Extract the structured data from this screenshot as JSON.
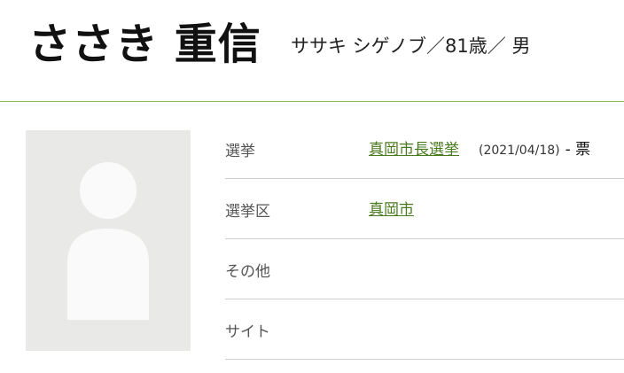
{
  "candidate": {
    "name": "ささき 重信",
    "subtitle": "ササキ シゲノブ／81歳／ 男"
  },
  "photo": {
    "icon": "person-placeholder-icon"
  },
  "details": {
    "election": {
      "label": "選挙",
      "link": "真岡市長選挙",
      "date": "(2021/04/18)",
      "votes": "- 票"
    },
    "district": {
      "label": "選挙区",
      "link": "真岡市"
    },
    "other": {
      "label": "その他"
    },
    "site": {
      "label": "サイト"
    }
  },
  "colors": {
    "accent_line": "#8cc152",
    "link": "#4a7a1e",
    "photo_bg": "#e9e9e7"
  }
}
